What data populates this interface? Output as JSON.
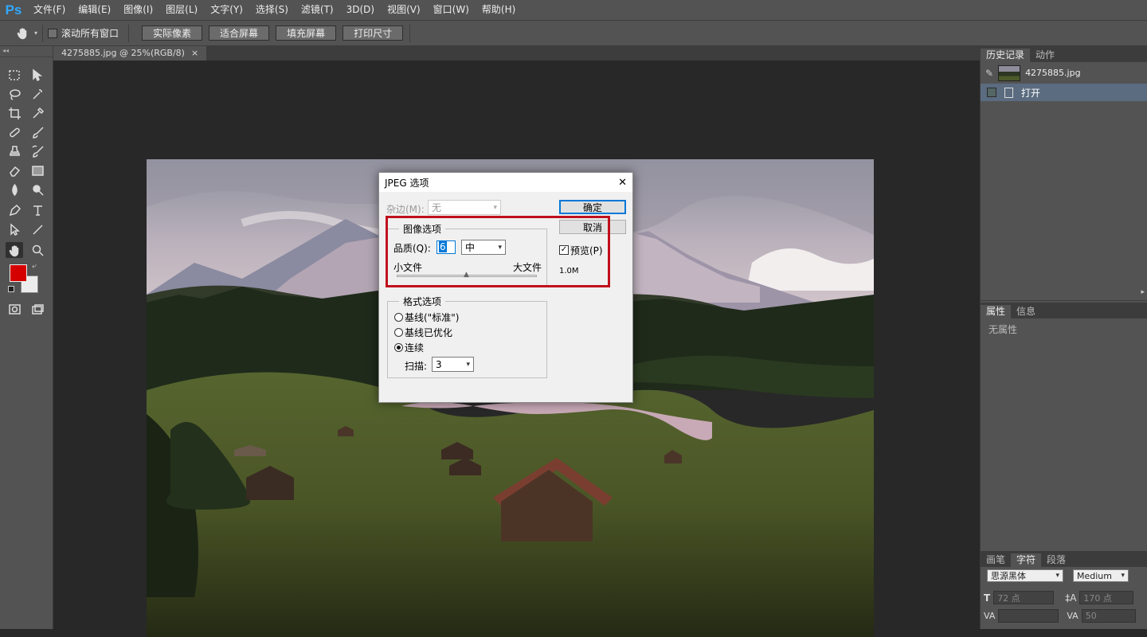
{
  "app": {
    "logo": "Ps"
  },
  "menu": [
    "文件(F)",
    "编辑(E)",
    "图像(I)",
    "图层(L)",
    "文字(Y)",
    "选择(S)",
    "滤镜(T)",
    "3D(D)",
    "视图(V)",
    "窗口(W)",
    "帮助(H)"
  ],
  "options_bar": {
    "scroll_all_label": "滚动所有窗口",
    "buttons": [
      "实际像素",
      "适合屏幕",
      "填充屏幕",
      "打印尺寸"
    ]
  },
  "document": {
    "tab_title": "4275885.jpg @ 25%(RGB/8)",
    "close": "×"
  },
  "colors": {
    "foreground": "#d40000",
    "background": "#ececec",
    "highlight": "#c0101c"
  },
  "history_panel": {
    "tabs": [
      "历史记录",
      "动作"
    ],
    "snapshot_name": "4275885.jpg",
    "items": [
      "打开"
    ]
  },
  "properties_panel": {
    "tabs": [
      "属性",
      "信息"
    ],
    "empty_text": "无属性"
  },
  "character_panel": {
    "tabs": [
      "画笔",
      "字符",
      "段落"
    ],
    "font_family": "思源黑体",
    "font_style": "Medium",
    "font_size": "72 点",
    "leading": "170 点",
    "tracking": "50"
  },
  "dialog": {
    "title": "JPEG 选项",
    "close": "✕",
    "matte_label": "杂边(M):",
    "matte_value": "无",
    "ok": "确定",
    "cancel": "取消",
    "preview": "预览(P)",
    "file_size": "1.0M",
    "image_options": {
      "legend": "图像选项",
      "quality_label": "品质(Q):",
      "quality_value": "6",
      "quality_preset": "中",
      "small_file": "小文件",
      "large_file": "大文件",
      "slider_fraction": 0.5
    },
    "format_options": {
      "legend": "格式选项",
      "options": [
        "基线(\"标准\")",
        "基线已优化",
        "连续"
      ],
      "selected_index": 2,
      "scans_label": "扫描:",
      "scans_value": "3"
    }
  }
}
